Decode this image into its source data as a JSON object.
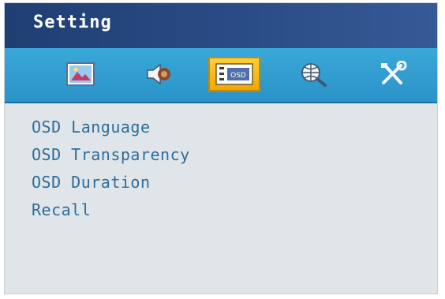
{
  "header": {
    "title": "Setting"
  },
  "tabs": [
    {
      "name": "picture",
      "icon": "picture-icon",
      "active": false
    },
    {
      "name": "audio",
      "icon": "speaker-icon",
      "active": false
    },
    {
      "name": "osd",
      "icon": "osd-setting-icon",
      "active": true,
      "icon_text": "OSD"
    },
    {
      "name": "input",
      "icon": "globe-magnifier-icon",
      "active": false
    },
    {
      "name": "tools",
      "icon": "tools-icon",
      "active": false
    }
  ],
  "menu": {
    "items": [
      "OSD Language",
      "OSD Transparency",
      "OSD Duration",
      "Recall"
    ]
  },
  "colors": {
    "title_bar": "#2a4c86",
    "icon_bar": "#2a93c8",
    "active_tab": "#f0a800",
    "menu_text": "#2d6d9c",
    "panel": "#dfe5e8"
  }
}
